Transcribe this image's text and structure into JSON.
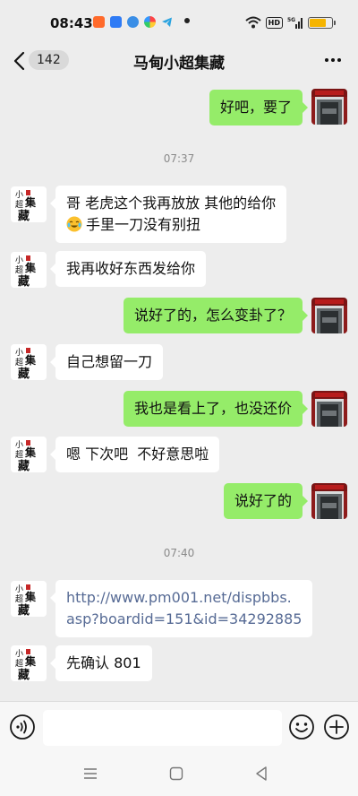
{
  "status": {
    "time": "08:43",
    "hd": "HD",
    "network": "5G"
  },
  "nav": {
    "unread": "142",
    "title": "马甸小超集藏"
  },
  "messages": [
    {
      "dir": "out",
      "text": "好吧，要了"
    },
    {
      "type": "time",
      "text": "07:37"
    },
    {
      "dir": "in",
      "text_line1": "哥 老虎这个我再放放 其他的给你",
      "text_line2": "手里一刀没有别扭"
    },
    {
      "dir": "in",
      "text": "我再收好东西发给你"
    },
    {
      "dir": "out",
      "text": "说好了的，怎么变卦了？"
    },
    {
      "dir": "in",
      "text": "自己想留一刀"
    },
    {
      "dir": "out",
      "text": "我也是看上了，也没还价"
    },
    {
      "dir": "in",
      "text": "嗯 下次吧  不好意思啦"
    },
    {
      "dir": "out",
      "text": "说好了的"
    },
    {
      "type": "time",
      "text": "07:40"
    },
    {
      "dir": "in",
      "link_line1": "http://www.pm001.net/dispbbs.",
      "link_line2": "asp?boardid=151&id=34292885"
    },
    {
      "dir": "in",
      "text": "先确认 801"
    }
  ],
  "avatar_text": {
    "c1": "小",
    "c2": "超",
    "c3": "集",
    "c4": "藏"
  },
  "icons": {
    "back": "chevron-left-icon",
    "more": "more-dots-icon",
    "voice": "voice-icon",
    "emoji": "emoji-icon",
    "plus": "plus-icon",
    "menu": "menu-icon",
    "home": "home-icon",
    "sysback": "triangle-back-icon"
  },
  "colors": {
    "bg": "#ededed",
    "outgoing": "#95ec69",
    "incoming": "#ffffff",
    "link": "#576b95"
  }
}
